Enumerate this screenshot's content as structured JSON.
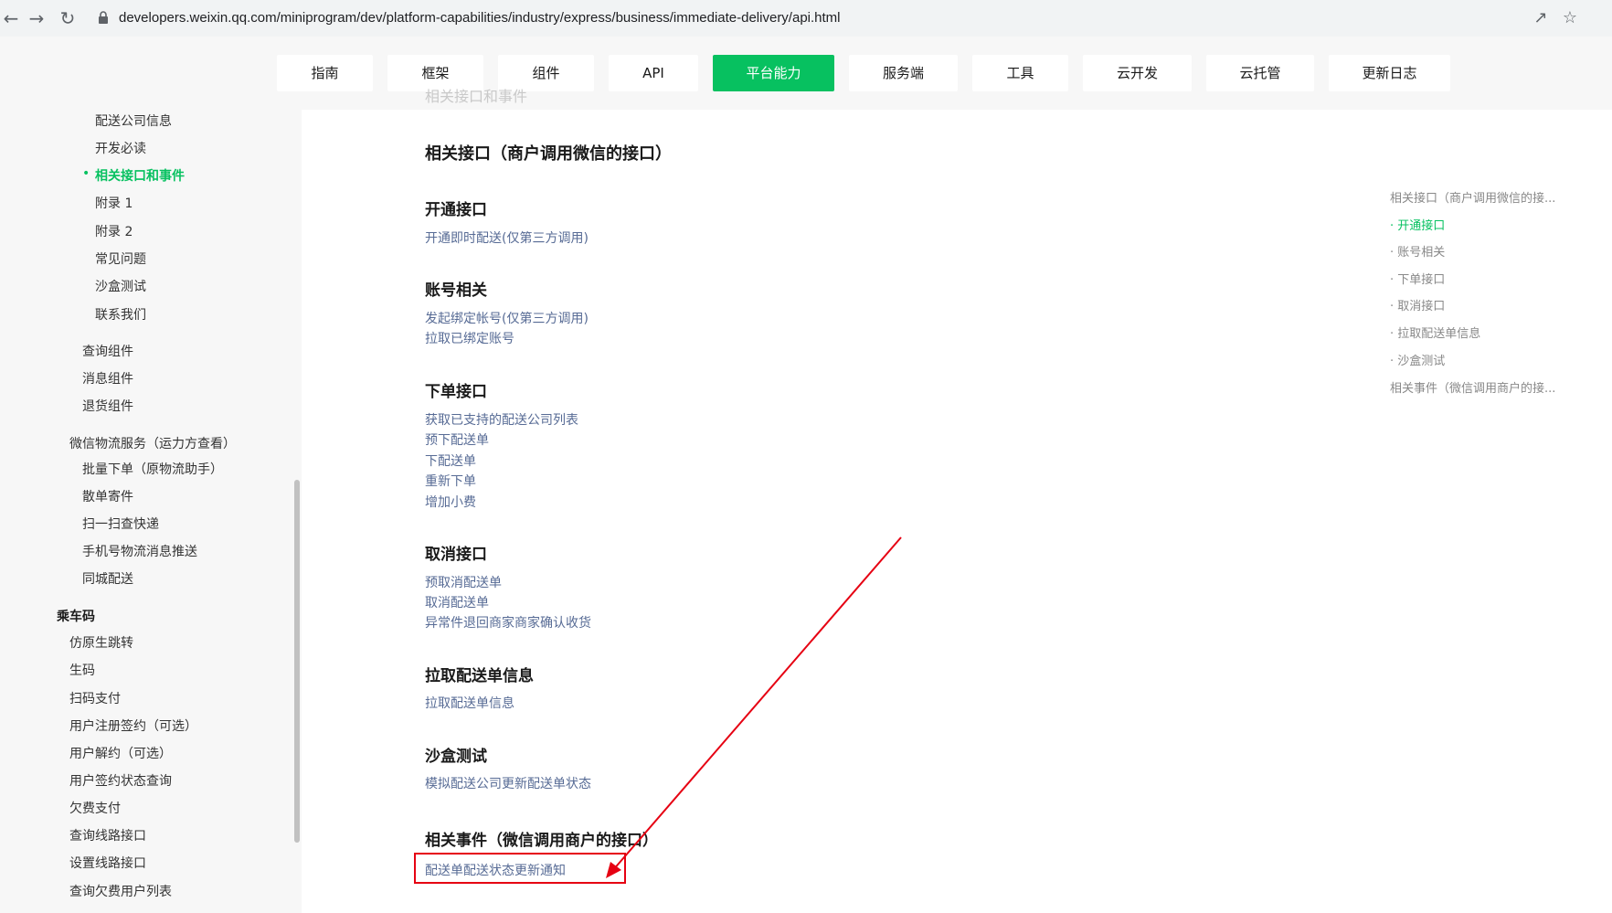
{
  "browser": {
    "url": "developers.weixin.qq.com/miniprogram/dev/platform-capabilities/industry/express/business/immediate-delivery/api.html",
    "back_icon": "arrow-left-icon",
    "forward_icon": "arrow-right-icon",
    "reload_icon": "reload-icon"
  },
  "topnav": {
    "tabs": [
      {
        "label": "指南"
      },
      {
        "label": "框架"
      },
      {
        "label": "组件"
      },
      {
        "label": "API"
      },
      {
        "label": "平台能力"
      },
      {
        "label": "服务端"
      },
      {
        "label": "工具"
      },
      {
        "label": "云开发"
      },
      {
        "label": "云托管"
      },
      {
        "label": "更新日志"
      }
    ],
    "active_index": 4,
    "ghost_title": "相关接口和事件"
  },
  "sidebar": {
    "items": [
      {
        "label": "配送公司信息"
      },
      {
        "label": "开发必读"
      },
      {
        "label": "相关接口和事件"
      },
      {
        "label": "附录 1"
      },
      {
        "label": "附录 2"
      },
      {
        "label": "常见问题"
      },
      {
        "label": "沙盒测试"
      },
      {
        "label": "联系我们"
      },
      {
        "label": "查询组件"
      },
      {
        "label": "消息组件"
      },
      {
        "label": "退货组件"
      },
      {
        "label": "微信物流服务（运力方查看）"
      },
      {
        "label": "批量下单（原物流助手）"
      },
      {
        "label": "散单寄件"
      },
      {
        "label": "扫一扫查快递"
      },
      {
        "label": "手机号物流消息推送"
      },
      {
        "label": "同城配送"
      },
      {
        "label": "乘车码"
      },
      {
        "label": "仿原生跳转"
      },
      {
        "label": "生码"
      },
      {
        "label": "扫码支付"
      },
      {
        "label": "用户注册签约（可选）"
      },
      {
        "label": "用户解约（可选）"
      },
      {
        "label": "用户签约状态查询"
      },
      {
        "label": "欠费支付"
      },
      {
        "label": "查询线路接口"
      },
      {
        "label": "设置线路接口"
      },
      {
        "label": "查询欠费用户列表"
      }
    ],
    "active_marker": "•"
  },
  "main": {
    "title": "相关接口（商户调用微信的接口）",
    "sections": [
      {
        "heading": "开通接口",
        "links": [
          "开通即时配送(仅第三方调用)"
        ]
      },
      {
        "heading": "账号相关",
        "links": [
          "发起绑定帐号(仅第三方调用)",
          "拉取已绑定账号"
        ]
      },
      {
        "heading": "下单接口",
        "links": [
          "获取已支持的配送公司列表",
          "预下配送单",
          "下配送单",
          "重新下单",
          "增加小费"
        ]
      },
      {
        "heading": "取消接口",
        "links": [
          "预取消配送单",
          "取消配送单",
          "异常件退回商家商家确认收货"
        ]
      },
      {
        "heading": "拉取配送单信息",
        "links": [
          "拉取配送单信息"
        ]
      },
      {
        "heading": "沙盒测试",
        "links": [
          "模拟配送公司更新配送单状态"
        ]
      },
      {
        "heading": "相关事件（微信调用商户的接口）",
        "links": [
          "配送单配送状态更新通知"
        ]
      }
    ]
  },
  "toc": {
    "items": [
      {
        "label": "相关接口（商户调用微信的接..."
      },
      {
        "label": "· 开通接口"
      },
      {
        "label": "· 账号相关"
      },
      {
        "label": "· 下单接口"
      },
      {
        "label": "· 取消接口"
      },
      {
        "label": "· 拉取配送单信息"
      },
      {
        "label": "· 沙盒测试"
      },
      {
        "label": "相关事件（微信调用商户的接..."
      }
    ],
    "active_index": 1
  },
  "colors": {
    "brand_green": "#07c160",
    "link_blue": "#576b95",
    "annotation_red": "#e60012"
  }
}
